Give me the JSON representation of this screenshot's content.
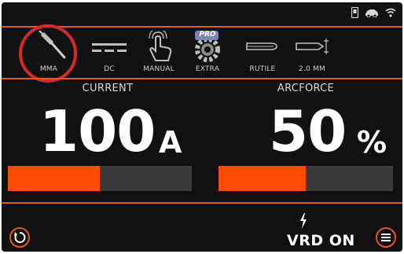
{
  "status": {
    "icons": [
      "usb-drive-icon",
      "car-icon",
      "wifi-icon"
    ]
  },
  "modes": [
    {
      "label": "MMA",
      "icon": "electrode-holder-icon",
      "selected": true
    },
    {
      "label": "DC",
      "icon": "direct-current-icon"
    },
    {
      "label": "MANUAL",
      "icon": "hand-touch-icon"
    },
    {
      "label": "EXTRA",
      "icon": "pro-gear-icon",
      "badge": "PRO"
    },
    {
      "label": "RUTILE",
      "icon": "rutile-electrode-icon"
    },
    {
      "label": "2.0 MM",
      "icon": "electrode-diameter-icon"
    }
  ],
  "current": {
    "title": "CURRENT",
    "value": "100",
    "unit": "A",
    "level": 0.5
  },
  "arcforce": {
    "title": "ARCFORCE",
    "value": "50",
    "unit": "%",
    "level": 0.5
  },
  "bottom": {
    "vrd_label": "VRD ON",
    "back_icon": "reset-icon",
    "menu_icon": "menu-icon",
    "vrd_icon": "lightning-icon"
  },
  "colors": {
    "accent": "#ff4a05",
    "highlight_circle": "#d62a2a",
    "background": "#111113",
    "bar_track": "#3a3a3c"
  }
}
